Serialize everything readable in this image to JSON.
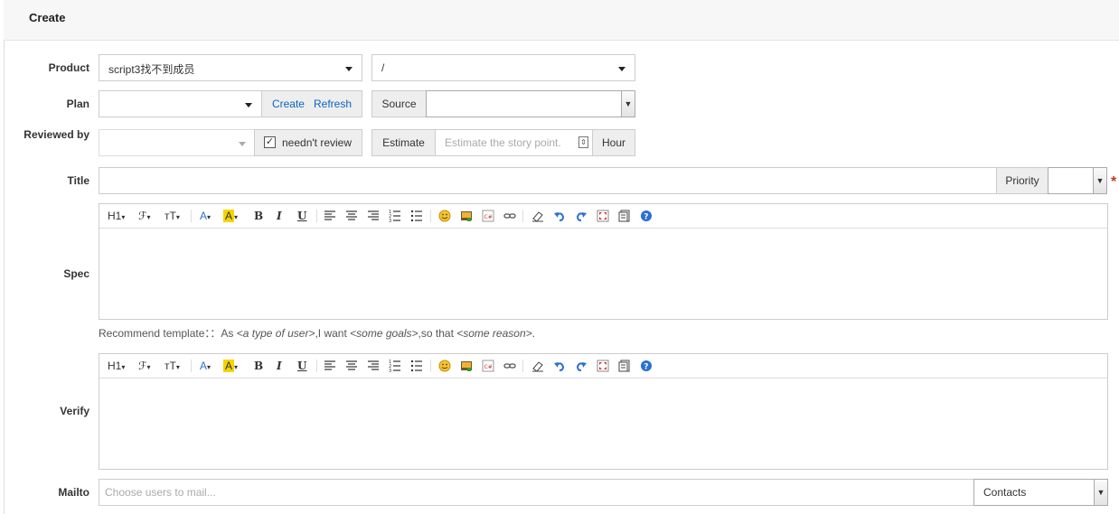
{
  "header": {
    "title": "Create"
  },
  "form": {
    "product": {
      "label": "Product",
      "value": "script3找不到成员",
      "branch_value": "/"
    },
    "plan": {
      "label": "Plan",
      "value": "",
      "create_label": "Create",
      "refresh_label": "Refresh",
      "source_label": "Source",
      "source_value": ""
    },
    "reviewed_by": {
      "label": "Reviewed by",
      "value": "",
      "neednt_review_label": "needn't review",
      "neednt_review_checked": true
    },
    "estimate": {
      "label": "Estimate",
      "placeholder": "Estimate the story point.",
      "unit": "Hour"
    },
    "title": {
      "label": "Title",
      "value": "",
      "priority_label": "Priority",
      "priority_value": "",
      "required_mark": "*"
    },
    "spec": {
      "label": "Spec"
    },
    "recommend": {
      "prefix": "Recommend template：：As ",
      "user": "<a type of user>",
      "mid1": ",I want ",
      "goals": "<some goals>",
      "mid2": ",so that ",
      "reason": "<some reason>",
      "end": "."
    },
    "verify": {
      "label": "Verify"
    },
    "mailto": {
      "label": "Mailto",
      "placeholder": "Choose users to mail...",
      "contacts_label": "Contacts"
    }
  },
  "toolbar": {
    "heading": "H1",
    "font": "ℱ",
    "size": "ᴛT",
    "bold": "B",
    "italic": "I",
    "underline": "U",
    "forecolor": "A",
    "hilite": "A"
  },
  "colors": {
    "link": "#0c64c0",
    "required": "#c0392b",
    "hilite_bg": "#f5d400",
    "forecolor": "#2f6fd0"
  }
}
